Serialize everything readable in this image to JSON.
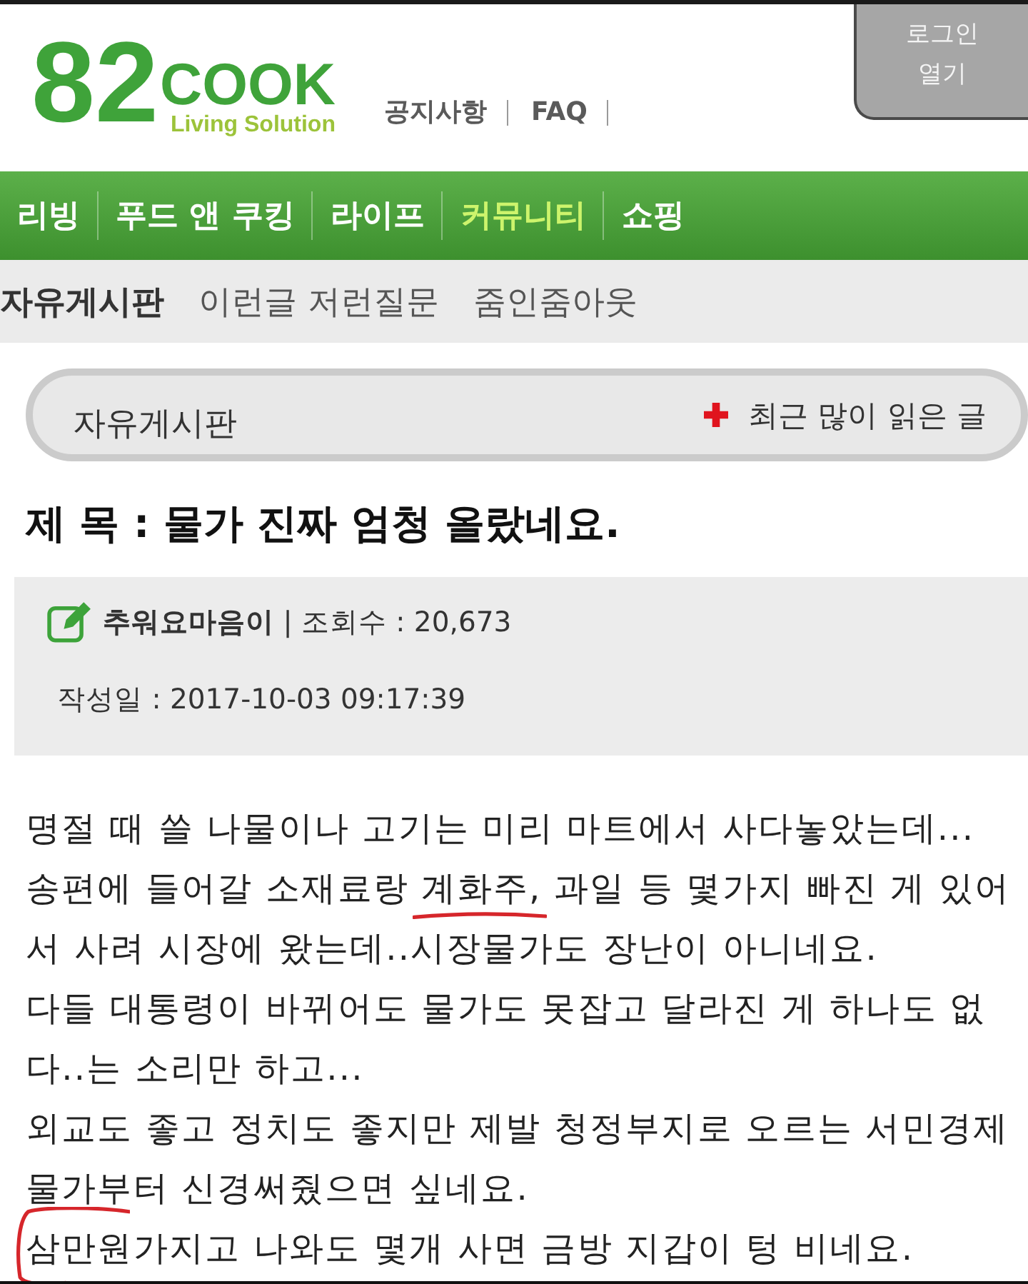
{
  "header": {
    "logo": {
      "number": "82",
      "wordmark": "COOK",
      "tagline": "Living Solution"
    },
    "links": [
      "공지사항",
      "FAQ"
    ],
    "login_button": {
      "label": "로그인\n열기"
    }
  },
  "nav": {
    "items": [
      {
        "label": "리빙",
        "selected": false
      },
      {
        "label": "푸드 앤 쿠킹",
        "selected": false
      },
      {
        "label": "라이프",
        "selected": false
      },
      {
        "label": "커뮤니티",
        "selected": true
      },
      {
        "label": "쇼핑",
        "selected": false
      }
    ]
  },
  "sub_nav": {
    "items": [
      {
        "label": "자유게시판",
        "selected": true
      },
      {
        "label": "이런글 저런질문",
        "selected": false
      },
      {
        "label": "줌인줌아웃",
        "selected": false
      }
    ]
  },
  "board_bar": {
    "title": "자유게시판",
    "link": "최근 많이 읽은 글"
  },
  "post": {
    "title": "제 목 : 물가 진짜 엄청 올랐네요.",
    "meta": "**추워요마음이** | 조회수 : 20,673",
    "date": "작성일 : 2017-10-03 09:17:39",
    "body_lines": [
      {
        "segments": [
          {
            "kind": "plain",
            "text": "명절 때 쓸 나물이나 고기는 미리 마트에서 사다놓았는데..."
          }
        ]
      },
      {
        "segments": [
          {
            "kind": "plain",
            "text": "송편에 들어갈 소재료랑 "
          },
          {
            "kind": "underlined",
            "text": "계화주,"
          },
          {
            "kind": "plain",
            "text": " 과일 등 몇가지 빠진 게 있어"
          }
        ]
      },
      {
        "segments": [
          {
            "kind": "plain",
            "text": "서 사려 시장에 왔는데..시장물가도 장난이 아니네요."
          }
        ]
      },
      {
        "segments": [
          {
            "kind": "plain",
            "text": "다들 대통령이 바뀌어도 물가도 못잡고 달라진 게 하나도 없"
          }
        ]
      },
      {
        "segments": [
          {
            "kind": "plain",
            "text": "다..는 소리만 하고..."
          }
        ]
      },
      {
        "segments": [
          {
            "kind": "plain",
            "text": "외교도 좋고 정치도 좋지만 제발 청정부지로 오르는 서민경제"
          }
        ]
      },
      {
        "segments": [
          {
            "kind": "plain",
            "text": "물가부터 신경써줬으면 싶네요."
          }
        ]
      },
      {
        "segments": [
          {
            "kind": "circled",
            "text": "삼만원"
          },
          {
            "kind": "plain",
            "text": "가지고 나와도 몇개 사면 금방 지갑이 텅 비네요."
          }
        ]
      }
    ]
  }
}
